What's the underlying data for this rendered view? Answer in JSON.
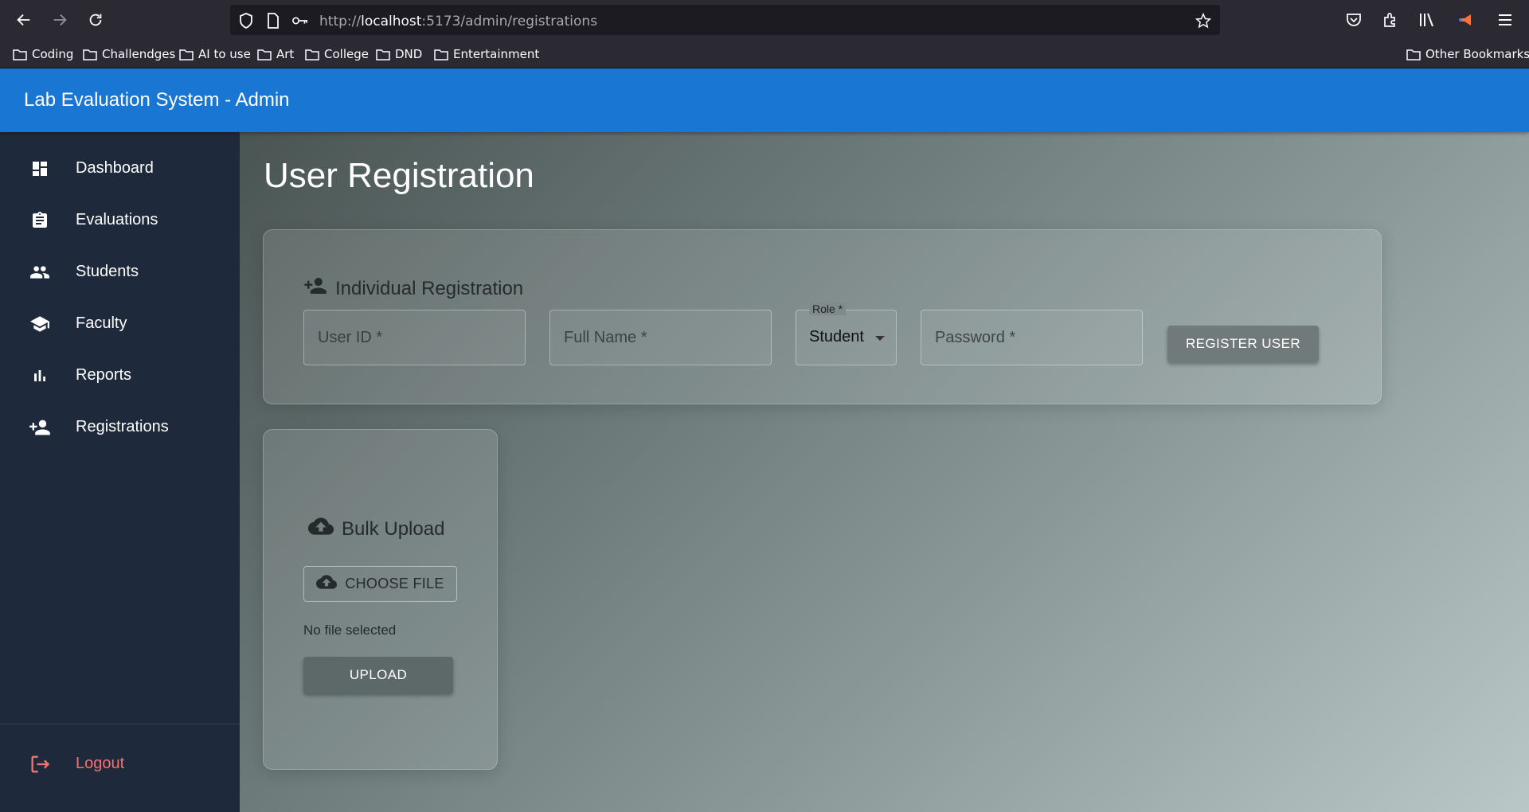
{
  "browser": {
    "url_prefix": "http://",
    "url_host": "localhost",
    "url_rest": ":5173/admin/registrations",
    "bookmarks": [
      "Coding",
      "Challendges",
      "AI to use",
      "Art",
      "College",
      "DND",
      "Entertainment"
    ],
    "other_bookmarks": "Other Bookmarks"
  },
  "app": {
    "title": "Lab Evaluation System - Admin",
    "accent": "#1976d2"
  },
  "sidebar": {
    "items": [
      {
        "label": "Dashboard",
        "icon": "dashboard-icon"
      },
      {
        "label": "Evaluations",
        "icon": "clipboard-icon"
      },
      {
        "label": "Students",
        "icon": "people-icon"
      },
      {
        "label": "Faculty",
        "icon": "school-icon"
      },
      {
        "label": "Reports",
        "icon": "bar-chart-icon"
      },
      {
        "label": "Registrations",
        "icon": "person-add-icon"
      }
    ],
    "logout": {
      "label": "Logout",
      "icon": "logout-icon",
      "color": "#f87171"
    }
  },
  "page": {
    "title": "User Registration"
  },
  "individual": {
    "title": "Individual Registration",
    "user_id_placeholder": "User ID *",
    "full_name_placeholder": "Full Name *",
    "role_label": "Role *",
    "role_value": "Student",
    "password_placeholder": "Password *",
    "register_button": "REGISTER USER"
  },
  "bulk": {
    "title": "Bulk Upload",
    "choose_button": "CHOOSE FILE",
    "file_status": "No file selected",
    "upload_button": "UPLOAD"
  }
}
